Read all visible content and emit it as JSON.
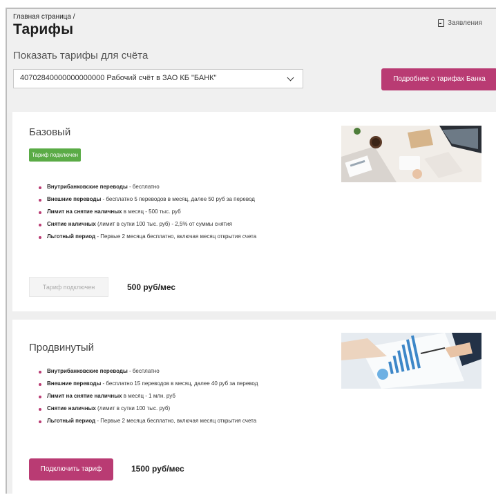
{
  "breadcrumb": "Главная страница /",
  "page_title": "Тарифы",
  "applications_link": "Заявления",
  "subtitle": "Показать тарифы для счёта",
  "account_select": {
    "value": "40702840000000000000 Рабочий счёт в ЗАО КБ \"БАНК\""
  },
  "more_button": "Подробнее о тарифах Банка",
  "tariffs": [
    {
      "name": "Базовый",
      "badge": "Тариф подключен",
      "features": [
        {
          "title": "Внутрибанковские переводы",
          "text": " - бесплатно"
        },
        {
          "title": "Внешние переводы",
          "text": " - бесплатно 5 переводов в месяц, далее 50 руб за перевод"
        },
        {
          "title": "Лимит на снятие наличных",
          "text": " в месяц - 500 тыс. руб"
        },
        {
          "title": "Снятие наличных",
          "text": " (лимит в сутки 100 тыс. руб) - 2,5% от суммы снятия"
        },
        {
          "title": "Льготный период",
          "text": " - Первые 2 месяца бесплатно, включая месяц открытия счета"
        }
      ],
      "button": "Тариф подключен",
      "price": "500 руб/мес"
    },
    {
      "name": "Продвинутый",
      "features": [
        {
          "title": "Внутрибанковские переводы",
          "text": " - бесплатно"
        },
        {
          "title": "Внешние переводы",
          "text": " - бесплатно 15 переводов в месяц, далее 40 руб за перевод"
        },
        {
          "title": "Лимит на снятие наличных",
          "text": " в месяц - 1 млн. руб"
        },
        {
          "title": "Снятие наличных",
          "text": " (лимит в сутки 100 тыс. руб)"
        },
        {
          "title": "Льготный период",
          "text": " - Первые 2 месяца бесплатно, включая месяц открытия счета"
        }
      ],
      "button": "Подключить тариф",
      "price": "1500 руб/мес"
    }
  ],
  "colors": {
    "accent": "#b93b73",
    "active_badge": "#5aab46",
    "background": "#efefef"
  }
}
